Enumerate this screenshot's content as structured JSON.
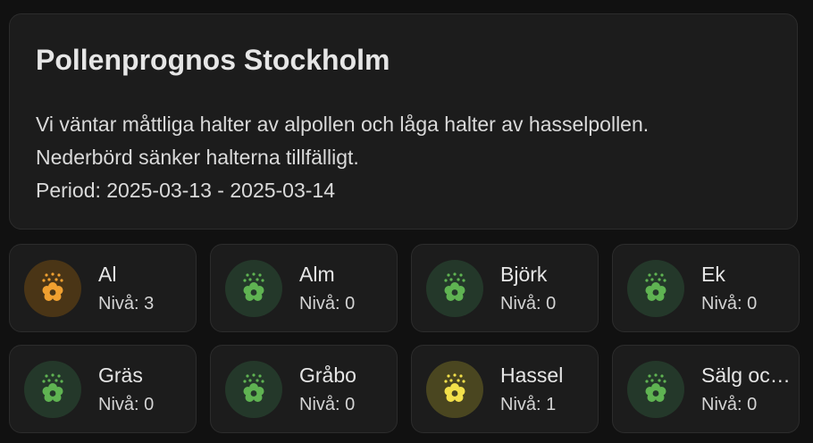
{
  "summary": {
    "title": "Pollenprognos Stockholm",
    "line1": "Vi väntar måttliga halter av alpollen och låga halter av hasselpollen.",
    "line2": "Nederbörd sänker halterna tillfälligt.",
    "line3": "Period: 2025-03-13 - 2025-03-14"
  },
  "pollen": [
    {
      "name": "Al",
      "level_text": "Nivå: 3",
      "level": 3,
      "icon": "flower-icon",
      "color": "#f0a030",
      "bg": "#4a3516"
    },
    {
      "name": "Alm",
      "level_text": "Nivå: 0",
      "level": 0,
      "icon": "flower-icon",
      "color": "#5fb352",
      "bg": "#24382a"
    },
    {
      "name": "Björk",
      "level_text": "Nivå: 0",
      "level": 0,
      "icon": "flower-icon",
      "color": "#5fb352",
      "bg": "#24382a"
    },
    {
      "name": "Ek",
      "level_text": "Nivå: 0",
      "level": 0,
      "icon": "flower-icon",
      "color": "#5fb352",
      "bg": "#24382a"
    },
    {
      "name": "Gräs",
      "level_text": "Nivå: 0",
      "level": 0,
      "icon": "flower-icon",
      "color": "#5fb352",
      "bg": "#24382a"
    },
    {
      "name": "Gråbo",
      "level_text": "Nivå: 0",
      "level": 0,
      "icon": "flower-icon",
      "color": "#5fb352",
      "bg": "#24382a"
    },
    {
      "name": "Hassel",
      "level_text": "Nivå: 1",
      "level": 1,
      "icon": "flower-icon",
      "color": "#f2e04a",
      "bg": "#4a4620"
    },
    {
      "name": "Sälg och viden",
      "level_text": "Nivå: 0",
      "level": 0,
      "icon": "flower-icon",
      "color": "#5fb352",
      "bg": "#24382a"
    }
  ]
}
